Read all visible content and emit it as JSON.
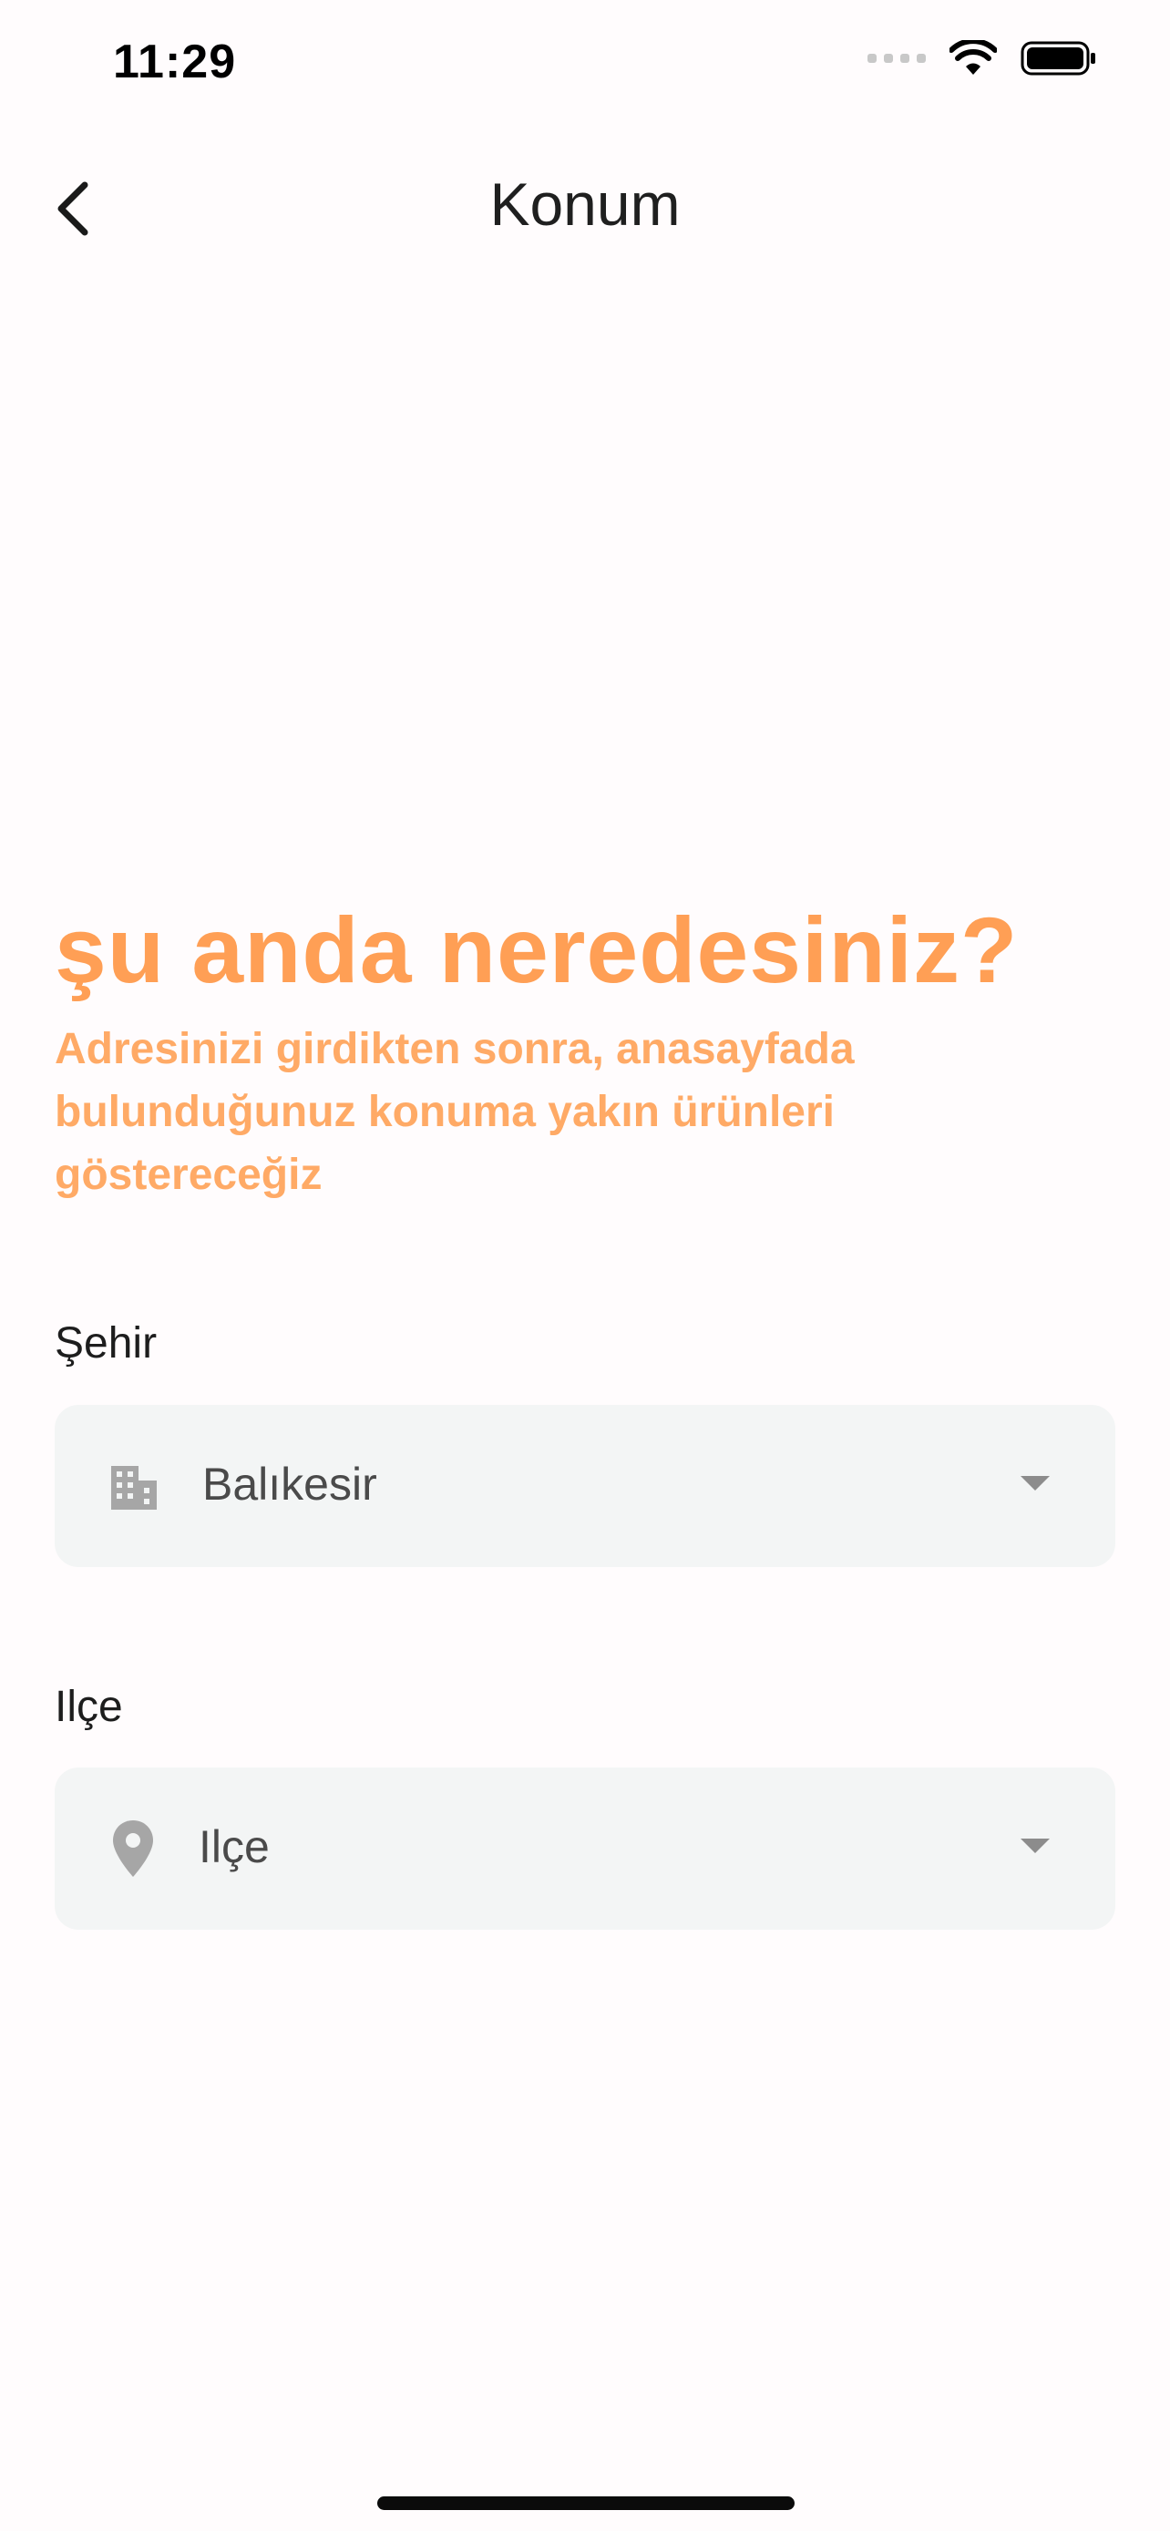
{
  "status_bar": {
    "time": "11:29"
  },
  "app_bar": {
    "title": "Konum",
    "back_icon": "chevron-left-icon"
  },
  "intro": {
    "heading": "şu anda neredesiniz?",
    "description": "Adresinizi girdikten sonra, anasayfada bulunduğunuz konuma yakın ürünleri göstereceğiz"
  },
  "form": {
    "city": {
      "label": "Şehir",
      "value": "Balıkesir",
      "icon": "city-building-icon"
    },
    "district": {
      "label": "Ilçe",
      "placeholder": "Ilçe",
      "icon": "location-pin-icon"
    }
  },
  "colors": {
    "accent": "#FF9F55",
    "field_background": "#F3F5F5",
    "page_background": "#FFFCFD"
  }
}
